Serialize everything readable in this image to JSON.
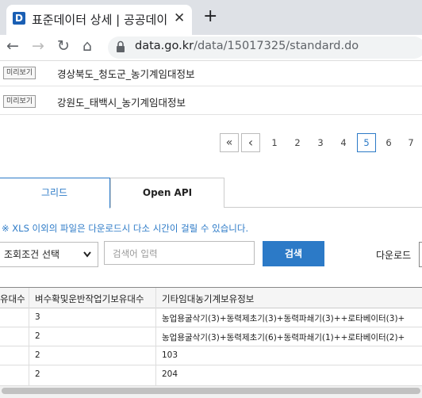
{
  "browser": {
    "tab_title": "표준데이터 상세 | 공공데이",
    "favicon_letter": "D",
    "close_glyph": "✕",
    "newtab_glyph": "+",
    "back_glyph": "←",
    "forward_glyph": "→",
    "reload_glyph": "↻",
    "home_glyph": "⌂",
    "url_host": "data.go.kr",
    "url_path": "/data/15017325/standard.do"
  },
  "list": [
    {
      "button": "미리보기",
      "title": "경상북도_청도군_농기계임대정보"
    },
    {
      "button": "미리보기",
      "title": "강원도_태백시_농기계임대정보"
    }
  ],
  "pagination": {
    "first": "«",
    "prev": "‹",
    "pages": [
      "1",
      "2",
      "3",
      "4",
      "5",
      "6",
      "7"
    ],
    "active_page": "5"
  },
  "content_tabs": [
    "그리드",
    "Open API"
  ],
  "notice": "※ XLS 이외의 파일은 다운로드시 다소 시간이 걸릴 수 있습니다.",
  "search_form": {
    "select_value": "조회조건 선택",
    "select_chevron": "⌄",
    "input_placeholder": "검색어 입력",
    "search_button": "검색",
    "download_label": "다운로드"
  },
  "table": {
    "headers": [
      "유대수",
      "벼수확및운반작업기보유대수",
      "기타임대농기계보유정보"
    ],
    "rows": [
      [
        "",
        "3",
        "농업용굴삭기(3)+동력제초기(3)+동력파쇄기(3)++로타베이터(3)+"
      ],
      [
        "",
        "2",
        "농업용굴삭기(3)+동력제초기(6)+동력파쇄기(1)++로타베이터(2)+"
      ],
      [
        "",
        "2",
        "103"
      ],
      [
        "",
        "2",
        "204"
      ]
    ]
  },
  "colors": {
    "accent": "#2c7ac7",
    "brand": "#1a5fb4"
  }
}
